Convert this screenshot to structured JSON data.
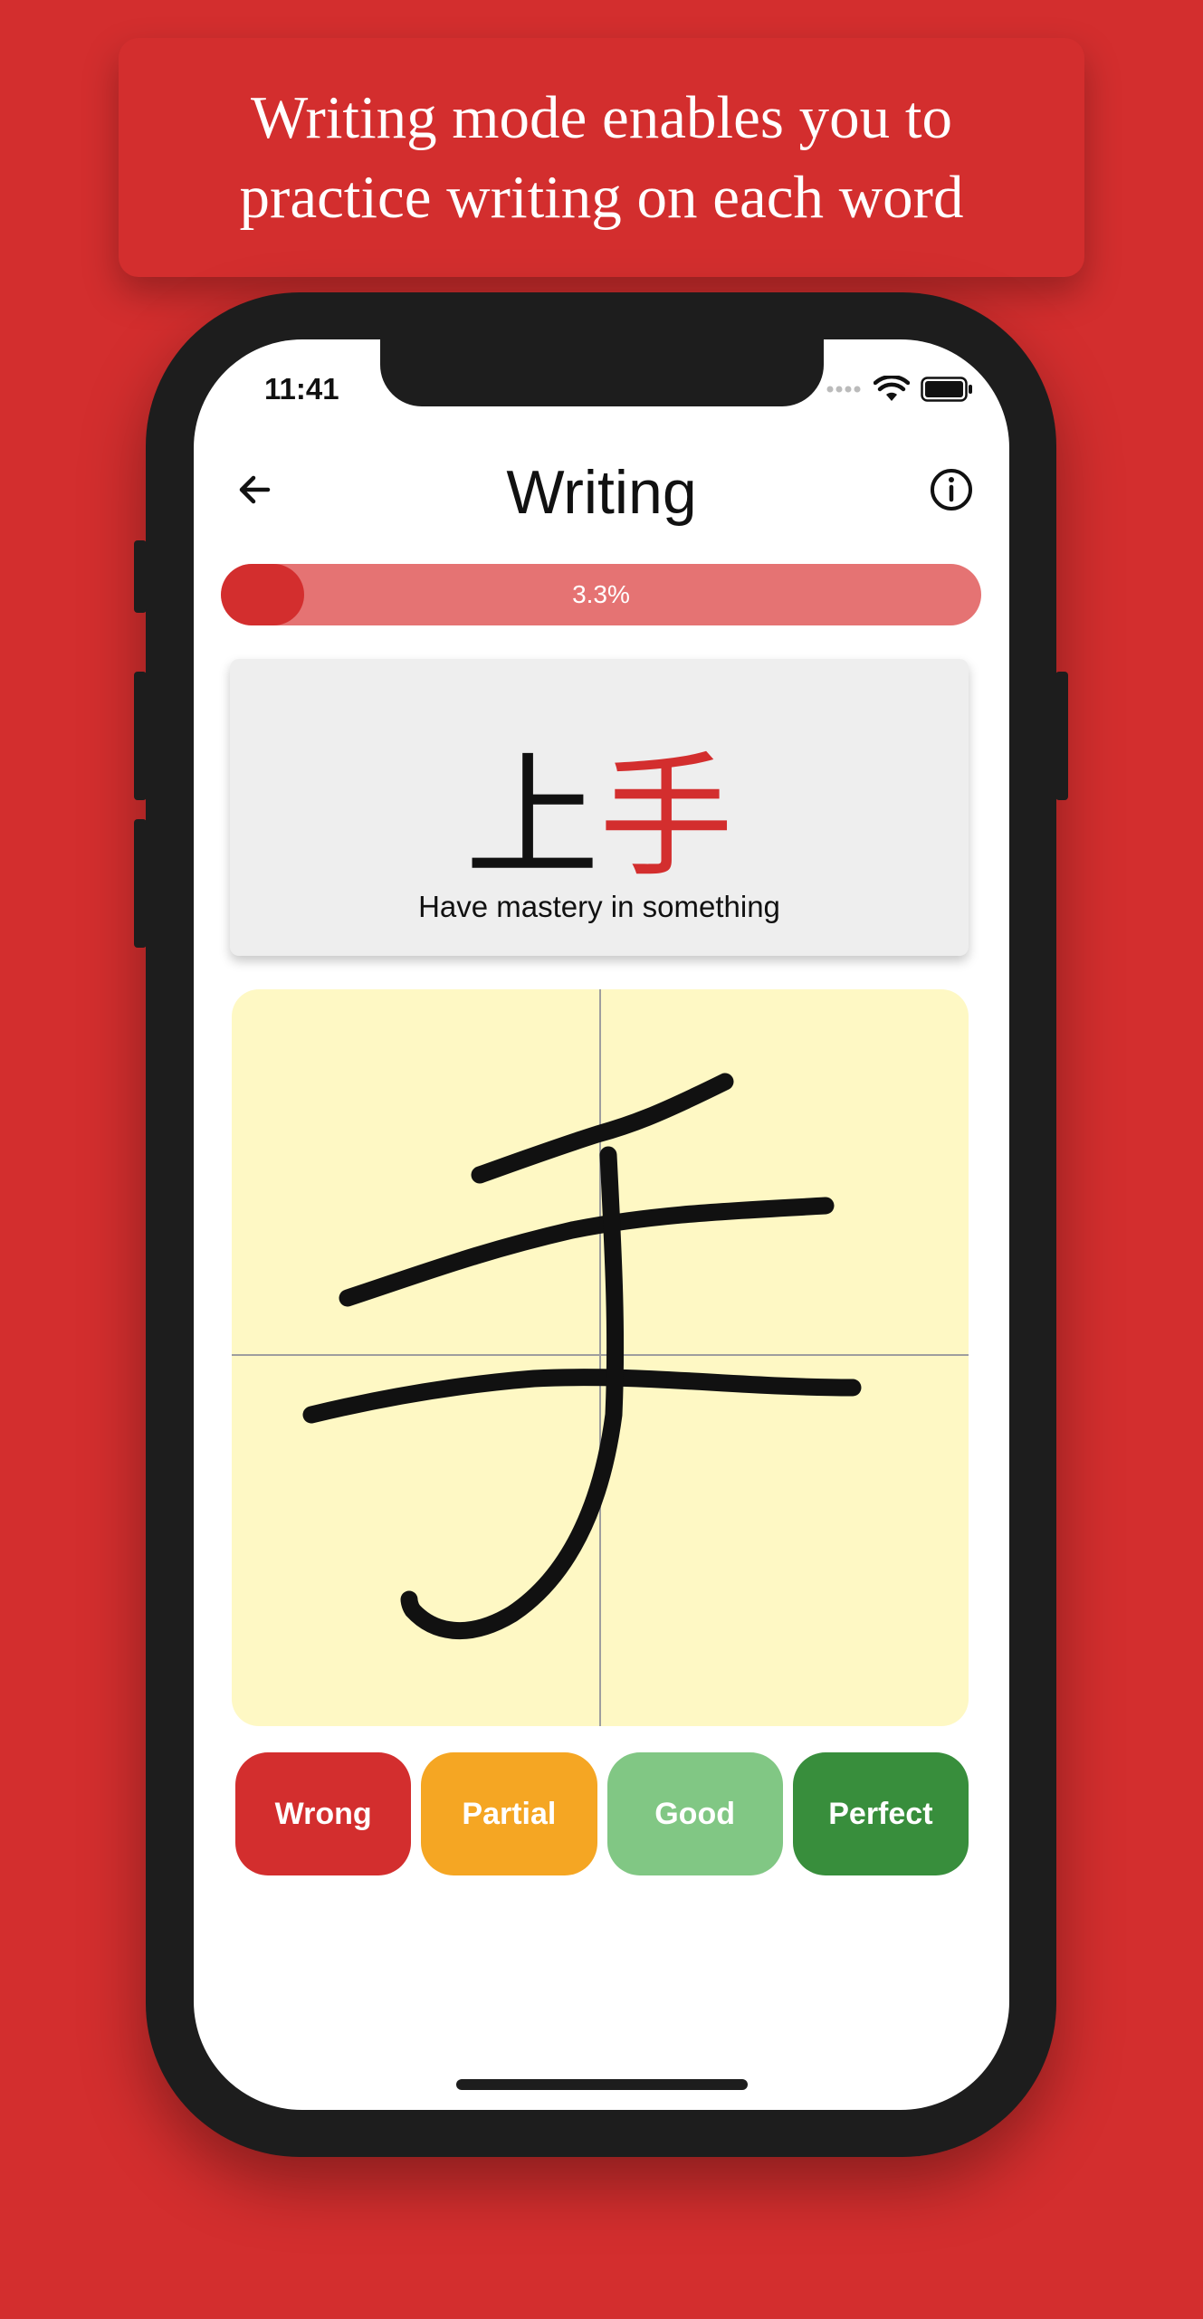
{
  "banner": {
    "line1": "Writing mode enables you to",
    "line2": "practice writing on each word"
  },
  "status_bar": {
    "time": "11:41",
    "icons": [
      "signal-dots-icon",
      "wifi-icon",
      "battery-icon"
    ]
  },
  "nav": {
    "back_icon": "arrow-left-icon",
    "title": "Writing",
    "info_icon": "info-icon"
  },
  "progress": {
    "label": "3.3%",
    "fraction": 0.033
  },
  "word_card": {
    "kanji_first": "上",
    "kanji_target": "手",
    "meaning": "Have mastery in something"
  },
  "writing_canvas": {
    "background_color": "#fef8c4",
    "stroke_color": "#111111",
    "guide_color": "#9e9e9e"
  },
  "grades": [
    {
      "label": "Wrong",
      "color": "#d32e2e"
    },
    {
      "label": "Partial",
      "color": "#f5a623"
    },
    {
      "label": "Good",
      "color": "#81c784"
    },
    {
      "label": "Perfect",
      "color": "#388e3c"
    }
  ],
  "colors": {
    "brand_red": "#d32e2e",
    "progress_track": "#e57373",
    "card_bg": "#eeeeee"
  }
}
